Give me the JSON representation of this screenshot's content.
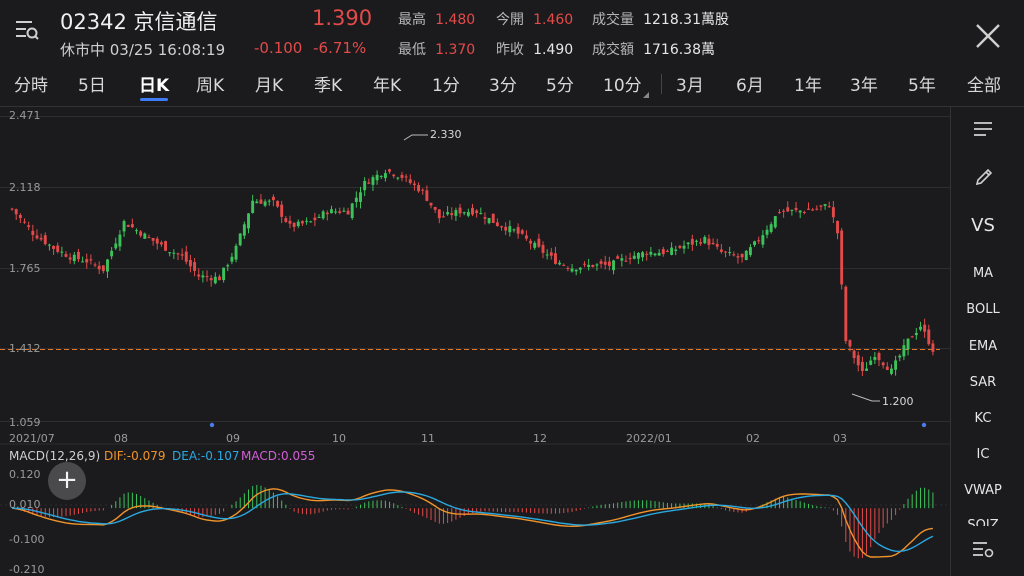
{
  "header": {
    "code": "02342",
    "name": "京信通信",
    "price": "1.390",
    "status": "休市中 03/25 16:08:19",
    "change": "-0.100",
    "change_pct": "-6.71%",
    "stats": [
      {
        "label": "最高",
        "value": "1.480",
        "tone": "up"
      },
      {
        "label": "今開",
        "value": "1.460",
        "tone": "up"
      },
      {
        "label": "成交量",
        "value": "1218.31萬股",
        "tone": "neutral"
      },
      {
        "label": "最低",
        "value": "1.370",
        "tone": "up"
      },
      {
        "label": "昨收",
        "value": "1.490",
        "tone": "neutral"
      },
      {
        "label": "成交額",
        "value": "1716.38萬",
        "tone": "neutral"
      }
    ]
  },
  "tabs": [
    "分時",
    "5日",
    "日K",
    "周K",
    "月K",
    "季K",
    "年K",
    "1分",
    "3分",
    "5分",
    "10分",
    "3月",
    "6月",
    "1年",
    "3年",
    "5年",
    "全部"
  ],
  "active_tab": "日K",
  "sidebar": {
    "vs_label": "VS",
    "indicators": [
      "MA",
      "BOLL",
      "EMA",
      "SAR",
      "KC",
      "IC",
      "VWAP",
      "SQJZ"
    ]
  },
  "colors": {
    "up": "#e34a4a",
    "down": "#3cc25a",
    "dif": "#f0932b",
    "dea": "#2aa8e0",
    "macd": "#d25fd6",
    "background": "#1b1b1d",
    "tab_underline": "#3d7cf5"
  },
  "chart_data": {
    "type": "candlestick",
    "y_ticks": [
      "2.471",
      "2.118",
      "1.765",
      "1.412",
      "1.059"
    ],
    "ylim": [
      1.059,
      2.471
    ],
    "x_ticks": [
      "2021/07",
      "08",
      "09",
      "10",
      "11",
      "12",
      "2022/01",
      "02",
      "03"
    ],
    "last_price_line": 1.39,
    "high_annotation": "2.330",
    "low_annotation": "1.200",
    "trend": [
      [
        0,
        2.04
      ],
      [
        5,
        1.93
      ],
      [
        10,
        1.86
      ],
      [
        14,
        1.82
      ],
      [
        18,
        1.8
      ],
      [
        22,
        1.76
      ],
      [
        27,
        1.98
      ],
      [
        31,
        1.93
      ],
      [
        36,
        1.87
      ],
      [
        41,
        1.82
      ],
      [
        45,
        1.73
      ],
      [
        50,
        1.72
      ],
      [
        54,
        1.86
      ],
      [
        58,
        2.08
      ],
      [
        63,
        2.07
      ],
      [
        67,
        1.96
      ],
      [
        72,
        1.98
      ],
      [
        76,
        2.03
      ],
      [
        81,
        2.03
      ],
      [
        85,
        2.16
      ],
      [
        90,
        2.22
      ],
      [
        94,
        2.19
      ],
      [
        99,
        2.12
      ],
      [
        103,
        2.0
      ],
      [
        108,
        2.03
      ],
      [
        112,
        2.03
      ],
      [
        117,
        1.97
      ],
      [
        121,
        1.94
      ],
      [
        126,
        1.87
      ],
      [
        131,
        1.8
      ],
      [
        135,
        1.77
      ],
      [
        140,
        1.78
      ],
      [
        144,
        1.78
      ],
      [
        149,
        1.82
      ],
      [
        153,
        1.84
      ],
      [
        158,
        1.84
      ],
      [
        162,
        1.87
      ],
      [
        167,
        1.9
      ],
      [
        171,
        1.84
      ],
      [
        176,
        1.81
      ],
      [
        180,
        1.9
      ],
      [
        185,
        2.03
      ],
      [
        189,
        2.03
      ],
      [
        194,
        2.04
      ],
      [
        197,
        2.06
      ],
      [
        199,
        1.93
      ],
      [
        201,
        1.43
      ],
      [
        205,
        1.28
      ],
      [
        208,
        1.37
      ],
      [
        212,
        1.29
      ],
      [
        216,
        1.43
      ],
      [
        219,
        1.5
      ],
      [
        222,
        1.39
      ]
    ],
    "macd": {
      "label": "MACD(12,26,9)",
      "dif_label": "DIF:-0.079",
      "dea_label": "DEA:-0.107",
      "macd_label": "MACD:0.055",
      "dif": -0.079,
      "dea": -0.107,
      "hist": 0.055,
      "y_ticks": [
        "0.120",
        "0.010",
        "-0.100",
        "-0.210"
      ]
    }
  }
}
